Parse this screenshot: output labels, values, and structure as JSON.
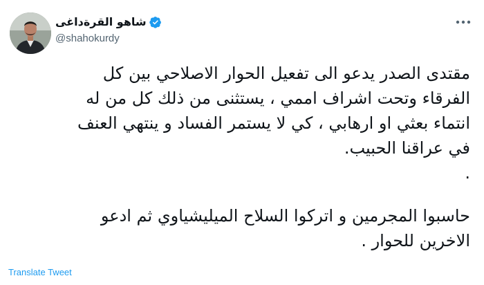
{
  "author": {
    "display_name": "شاهو القرةداغى",
    "handle": "@shahokurdy",
    "avatar_icon": "person-avatar",
    "verified_icon": "verified-badge-icon",
    "verified_color": "#1d9bf0"
  },
  "more_icon": "more-dots-icon",
  "tweet": {
    "lines": [
      "مقتدى الصدر يدعو الى تفعيل الحوار الاصلاحي بين كل",
      "الفرقاء وتحت اشراف اممي ، يستثنى من ذلك كل من له",
      "انتماء بعثي او ارهابي ، كي لا يستمر الفساد و ينتهي العنف",
      "في عراقنا الحبيب.",
      "."
    ],
    "lines2": [
      "حاسبوا المجرمين و اتركوا السلاح الميليشياوي ثم ادعو",
      "الاخرين للحوار ."
    ]
  },
  "translate_label": "Translate Tweet",
  "colors": {
    "text": "#0f1419",
    "secondary": "#536471",
    "link": "#1d9bf0"
  }
}
